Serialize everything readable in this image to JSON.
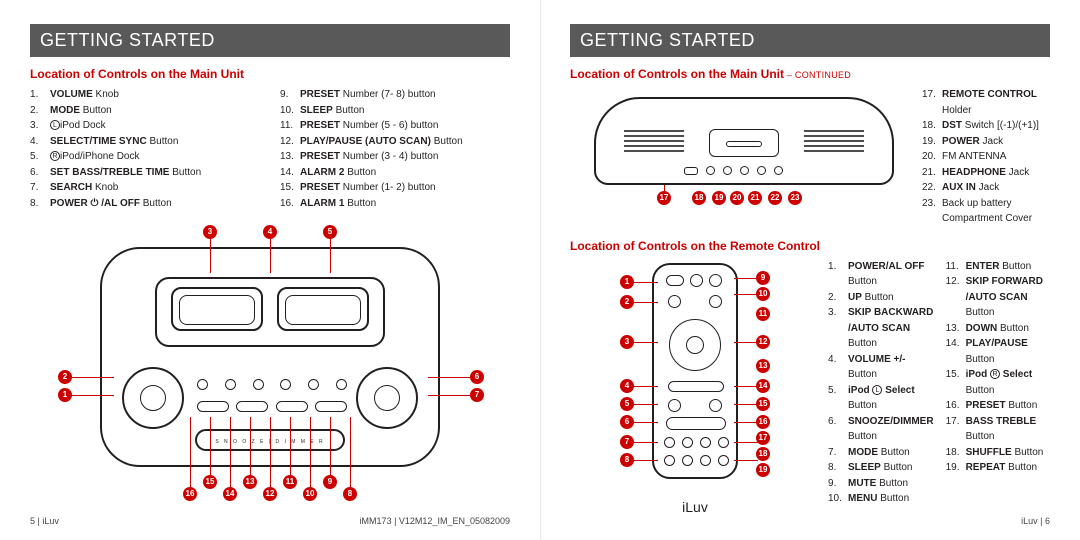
{
  "header": "GETTING STARTED",
  "left": {
    "subtitle": "Location of Controls on the Main Unit",
    "col1": [
      {
        "b": "VOLUME",
        "t": " Knob"
      },
      {
        "b": "MODE",
        "t": " Button"
      },
      {
        "b": "",
        "t": "iPod Dock ",
        "ring": "L"
      },
      {
        "b": "SELECT/TIME SYNC",
        "t": " Button"
      },
      {
        "b": "",
        "t": "iPod/iPhone Dock ",
        "ring": "R"
      },
      {
        "b": "SET BASS/TREBLE TIME",
        "t": " Button"
      },
      {
        "b": "SEARCH",
        "t": " Knob"
      },
      {
        "b": "POWER ⏻ /AL OFF",
        "t": " Button"
      }
    ],
    "col2": [
      {
        "b": "PRESET",
        "t": " Number (7- 8) button"
      },
      {
        "b": "SLEEP",
        "t": " Button"
      },
      {
        "b": "PRESET",
        "t": " Number (5 - 6) button"
      },
      {
        "b": "PLAY/PAUSE (AUTO SCAN)",
        "t": " Button"
      },
      {
        "b": "PRESET",
        "t": " Number (3 - 4) button"
      },
      {
        "b": "ALARM 2",
        "t": " Button"
      },
      {
        "b": "PRESET",
        "t": " Number (1- 2) button"
      },
      {
        "b": "ALARM 1",
        "t": " Button"
      }
    ],
    "snooze": "S N O O Z E  |  D I M M E R",
    "footL": "5 | iLuv",
    "footR": "iMM173  |  V12M12_IM_EN_05082009"
  },
  "right": {
    "subtitle": "Location of Controls on the Main Unit",
    "cont": " – CONTINUED",
    "rear": [
      {
        "b": "REMOTE CONTROL",
        "t": " Holder"
      },
      {
        "b": "DST",
        "t": " Switch [(-1)/(+1)]"
      },
      {
        "b": "POWER",
        "t": " Jack"
      },
      {
        "b": "",
        "t": "FM ANTENNA"
      },
      {
        "b": "HEADPHONE",
        "t": " Jack"
      },
      {
        "b": "AUX IN",
        "t": " Jack"
      },
      {
        "b": "",
        "t": "Back up battery Compartment Cover"
      }
    ],
    "sub2": "Location of Controls on the Remote Control",
    "rc1": [
      {
        "b": "POWER/AL OFF",
        "t": " Button"
      },
      {
        "b": "UP",
        "t": " Button"
      },
      {
        "b": "SKIP BACKWARD /AUTO SCAN",
        "t": " Button"
      },
      {
        "b": "VOLUME +/-",
        "t": " Button"
      },
      {
        "b": "iPod ",
        "ring": "L",
        "b2": " Select",
        "t": " Button"
      },
      {
        "b": "SNOOZE/DIMMER",
        "t": " Button"
      },
      {
        "b": "MODE",
        "t": " Button"
      },
      {
        "b": "SLEEP",
        "t": " Button"
      },
      {
        "b": "MUTE",
        "t": " Button"
      },
      {
        "b": "MENU",
        "t": " Button"
      }
    ],
    "rc2": [
      {
        "b": "ENTER",
        "t": " Button"
      },
      {
        "b": "SKIP FORWARD /AUTO SCAN",
        "t": " Button"
      },
      {
        "b": "DOWN",
        "t": " Button"
      },
      {
        "b": "PLAY/PAUSE",
        "t": " Button"
      },
      {
        "b": "iPod ",
        "ring": "R",
        "b2": " Select",
        "t": " Button"
      },
      {
        "b": "PRESET",
        "t": " Button"
      },
      {
        "b": "BASS TREBLE",
        "t": " Button"
      },
      {
        "b": "SHUFFLE",
        "t": " Button"
      },
      {
        "b": "REPEAT",
        "t": " Button"
      }
    ],
    "brand": "iLuv",
    "footR": "iLuv | 6"
  }
}
